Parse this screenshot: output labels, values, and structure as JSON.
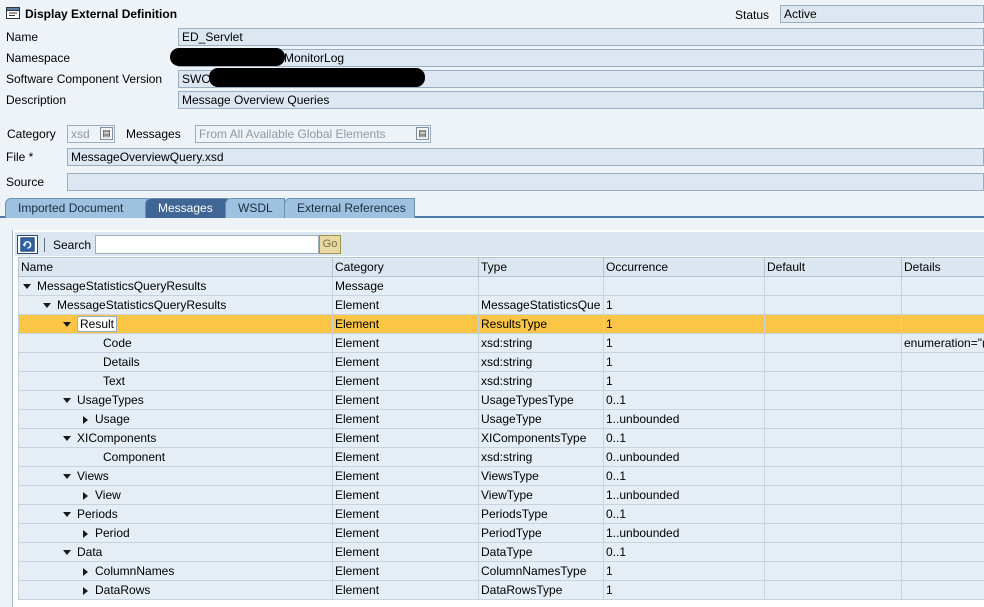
{
  "window": {
    "title": "Display External Definition"
  },
  "status": {
    "label": "Status",
    "value": "Active"
  },
  "form": {
    "name_label": "Name",
    "name_value": "ED_Servlet",
    "namespace_label": "Namespace",
    "namespace_value": "MonitorLog",
    "swcv_label": "Software Component Version",
    "swcv_value": "SWCV",
    "description_label": "Description",
    "description_value": "Message Overview Queries",
    "category_label": "Category",
    "category_value": "xsd",
    "messages_label": "Messages",
    "messages_value": "From All Available Global Elements",
    "file_label": "File *",
    "file_value": "MessageOverviewQuery.xsd",
    "source_label": "Source",
    "source_value": ""
  },
  "tabs": [
    {
      "label": "Imported Document"
    },
    {
      "label": "Messages"
    },
    {
      "label": "WSDL"
    },
    {
      "label": "External References"
    }
  ],
  "toolbar": {
    "search_label": "Search",
    "search_value": "",
    "go_label": "Go"
  },
  "table": {
    "columns": [
      "Name",
      "Category",
      "Type",
      "Occurrence",
      "Default",
      "Details"
    ],
    "rows": [
      {
        "name": "MessageStatisticsQueryResults",
        "category": "Message",
        "type": "",
        "occurrence": "",
        "default": "",
        "details": ""
      },
      {
        "name": "MessageStatisticsQueryResults",
        "category": "Element",
        "type": "MessageStatisticsQue",
        "occurrence": "1",
        "default": "",
        "details": ""
      },
      {
        "name": "Result",
        "category": "Element",
        "type": "ResultsType",
        "occurrence": "1",
        "default": "",
        "details": ""
      },
      {
        "name": "Code",
        "category": "Element",
        "type": "xsd:string",
        "occurrence": "1",
        "default": "",
        "details": "enumeration=\"("
      },
      {
        "name": "Details",
        "category": "Element",
        "type": "xsd:string",
        "occurrence": "1",
        "default": "",
        "details": ""
      },
      {
        "name": "Text",
        "category": "Element",
        "type": "xsd:string",
        "occurrence": "1",
        "default": "",
        "details": ""
      },
      {
        "name": "UsageTypes",
        "category": "Element",
        "type": "UsageTypesType",
        "occurrence": "0..1",
        "default": "",
        "details": ""
      },
      {
        "name": "Usage",
        "category": "Element",
        "type": "UsageType",
        "occurrence": "1..unbounded",
        "default": "",
        "details": ""
      },
      {
        "name": "XIComponents",
        "category": "Element",
        "type": "XIComponentsType",
        "occurrence": "0..1",
        "default": "",
        "details": ""
      },
      {
        "name": "Component",
        "category": "Element",
        "type": "xsd:string",
        "occurrence": "0..unbounded",
        "default": "",
        "details": ""
      },
      {
        "name": "Views",
        "category": "Element",
        "type": "ViewsType",
        "occurrence": "0..1",
        "default": "",
        "details": ""
      },
      {
        "name": "View",
        "category": "Element",
        "type": "ViewType",
        "occurrence": "1..unbounded",
        "default": "",
        "details": ""
      },
      {
        "name": "Periods",
        "category": "Element",
        "type": "PeriodsType",
        "occurrence": "0..1",
        "default": "",
        "details": ""
      },
      {
        "name": "Period",
        "category": "Element",
        "type": "PeriodType",
        "occurrence": "1..unbounded",
        "default": "",
        "details": ""
      },
      {
        "name": "Data",
        "category": "Element",
        "type": "DataType",
        "occurrence": "0..1",
        "default": "",
        "details": ""
      },
      {
        "name": "ColumnNames",
        "category": "Element",
        "type": "ColumnNamesType",
        "occurrence": "1",
        "default": "",
        "details": ""
      },
      {
        "name": "DataRows",
        "category": "Element",
        "type": "DataRowsType",
        "occurrence": "1",
        "default": "",
        "details": ""
      }
    ]
  }
}
